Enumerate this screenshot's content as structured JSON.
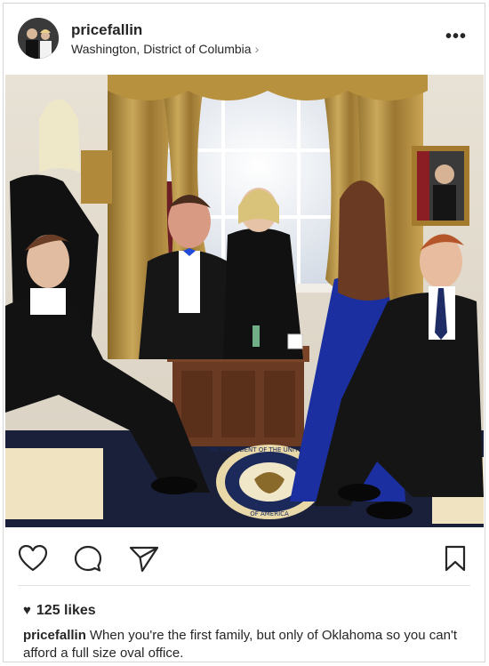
{
  "post": {
    "username": "pricefallin",
    "location": "Washington, District of Columbia",
    "location_chevron": "›",
    "more_label": "•••",
    "likes": "125 likes",
    "caption_user": "pricefallin",
    "caption_text": "When you're the first family, but only of Oklahoma so you can't afford a full size oval office.",
    "seal_top_text": "THE PRESIDENT OF THE UNITED STATES",
    "seal_bottom_text": "OF AMERICA"
  },
  "icons": {
    "like": "heart-outline-icon",
    "comment": "comment-bubble-icon",
    "share": "paper-plane-icon",
    "save": "bookmark-icon",
    "likes_heart": "heart-filled-icon"
  },
  "colors": {
    "text": "#262626",
    "secondary": "#8e8e8e",
    "curtain": "#b08a3a",
    "dress": "#1c2fa0",
    "rug": "#1a1f3a"
  }
}
